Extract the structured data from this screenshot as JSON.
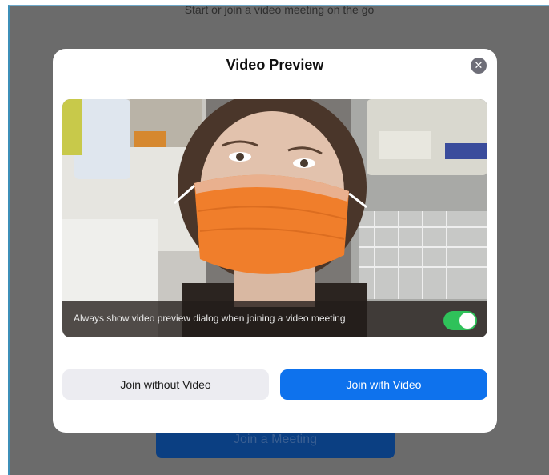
{
  "background": {
    "subtitle": "Start or join a video meeting on the go",
    "join_meeting_label": "Join a Meeting"
  },
  "dialog": {
    "title": "Video Preview",
    "close_icon": "close-icon",
    "preview": {
      "toggle_label": "Always show video preview dialog when joining a video meeting",
      "toggle_on": true
    },
    "buttons": {
      "without_video": "Join without Video",
      "with_video": "Join with Video"
    }
  },
  "colors": {
    "primary": "#0e72ed",
    "toggle_on": "#2fc25a",
    "secondary_button": "#ececf1",
    "backdrop": "#6b6b6b"
  }
}
